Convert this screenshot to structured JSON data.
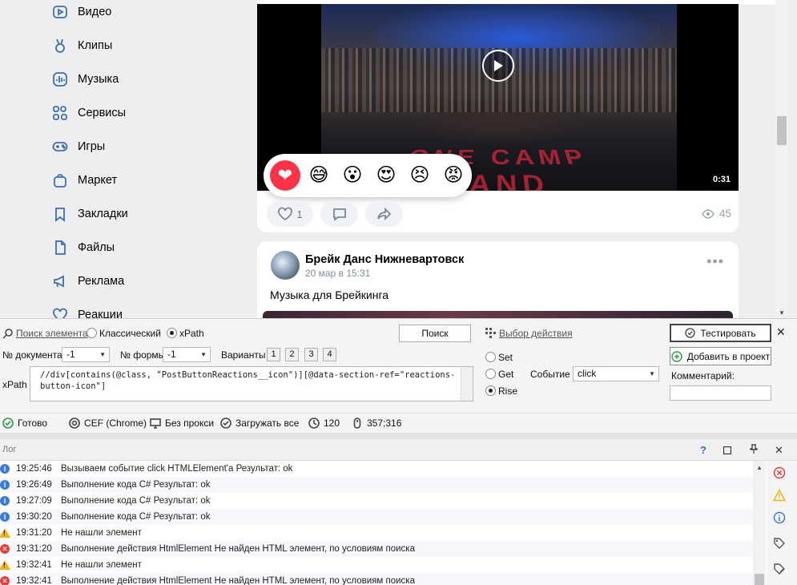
{
  "sidebar": {
    "items": [
      {
        "label": "Видео",
        "icon": "video-icon"
      },
      {
        "label": "Клипы",
        "icon": "clips-icon"
      },
      {
        "label": "Музыка",
        "icon": "music-icon"
      },
      {
        "label": "Сервисы",
        "icon": "services-icon"
      },
      {
        "label": "Игры",
        "icon": "gamepad-icon"
      },
      {
        "label": "Маркет",
        "icon": "shopping-bag-icon"
      },
      {
        "label": "Закладки",
        "icon": "bookmark-icon"
      },
      {
        "label": "Файлы",
        "icon": "file-icon"
      },
      {
        "label": "Реклама",
        "icon": "megaphone-icon"
      },
      {
        "label": "Реакции",
        "icon": "heart-icon"
      }
    ]
  },
  "video_post": {
    "duration": "0:31",
    "floor_text": "ONE CAMP LAND",
    "reactions": [
      "❤",
      "😅",
      "😮",
      "😍",
      "😣",
      "😡"
    ],
    "likes": "1",
    "views": "45"
  },
  "post": {
    "author": "Брейк Данс Нижневартовск",
    "time": "20 мар в 15:31",
    "text": "Музыка для Брейкинга",
    "more": "•••"
  },
  "panel": {
    "search_element": "Поиск элемента",
    "classic": "Классический",
    "xpath": "xPath",
    "search_button": "Поиск",
    "choose_action": "Выбор действия",
    "test_button": "Тестировать",
    "add_to_project": "Добавить в проект",
    "doc_no_label": "№ документа",
    "doc_no_value": "-1",
    "form_no_label": "№ формы",
    "form_no_value": "-1",
    "variants_label": "Варианты",
    "variants": [
      "1",
      "2",
      "3",
      "4"
    ],
    "xpath_label": "xPath",
    "xpath_value": "//div[contains(@class, \"PostButtonReactions__icon\")][@data-section-ref=\"reactions-button-icon\"]",
    "set": "Set",
    "get": "Get",
    "rise": "Rise",
    "event_label": "Событие",
    "event_value": "click",
    "comment_label": "Комментарий:",
    "close": "✕"
  },
  "status": {
    "ready": "Готово",
    "engine": "CEF (Chrome)",
    "proxy": "Без прокси",
    "load_all": "Загружать все",
    "timeout": "120",
    "coords": "357;316"
  },
  "log": {
    "title": "Лог",
    "help": "?",
    "rows": [
      {
        "type": "info",
        "time": "19:25:46",
        "msg": "Вызываем событие click HTMLElement'а  Результат: ok"
      },
      {
        "type": "info",
        "time": "19:26:49",
        "msg": "Выполнение кода C#  Результат: ok"
      },
      {
        "type": "info",
        "time": "19:27:09",
        "msg": "Выполнение кода C#  Результат: ok"
      },
      {
        "type": "info",
        "time": "19:30:20",
        "msg": "Выполнение кода C#  Результат: ok"
      },
      {
        "type": "warn",
        "time": "19:31:20",
        "msg": " Не нашли элемент"
      },
      {
        "type": "error",
        "time": "19:31:20",
        "msg": "Выполнение действия HtmlElement Не найден HTML элемент, по условиям поиска"
      },
      {
        "type": "warn",
        "time": "19:32:41",
        "msg": " Не нашли элемент"
      },
      {
        "type": "error",
        "time": "19:32:41",
        "msg": "Выполнение действия HtmlElement Не найден HTML элемент, по условиям поиска"
      }
    ]
  }
}
